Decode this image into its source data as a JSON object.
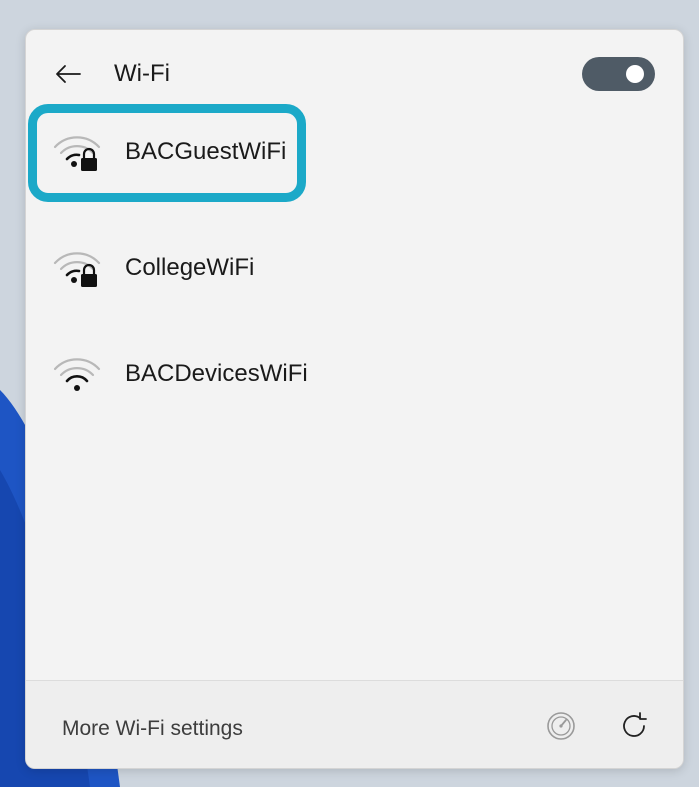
{
  "header": {
    "back_icon": "arrow-left-icon",
    "title": "Wi-Fi",
    "toggle_state": "on"
  },
  "networks": [
    {
      "name": "BACGuestWiFi",
      "secured": true,
      "icon": "wifi-lock-icon",
      "highlighted": true
    },
    {
      "name": "CollegeWiFi",
      "secured": true,
      "icon": "wifi-lock-icon",
      "highlighted": false
    },
    {
      "name": "BACDevicesWiFi",
      "secured": false,
      "icon": "wifi-icon",
      "highlighted": false
    }
  ],
  "footer": {
    "more_settings_label": "More Wi-Fi settings",
    "speed_icon": "gauge-icon",
    "refresh_icon": "refresh-icon"
  },
  "colors": {
    "highlight": "#1ba9c8",
    "toggle_on": "#4f5b66",
    "wallpaper_blue": "#1e55c4"
  }
}
